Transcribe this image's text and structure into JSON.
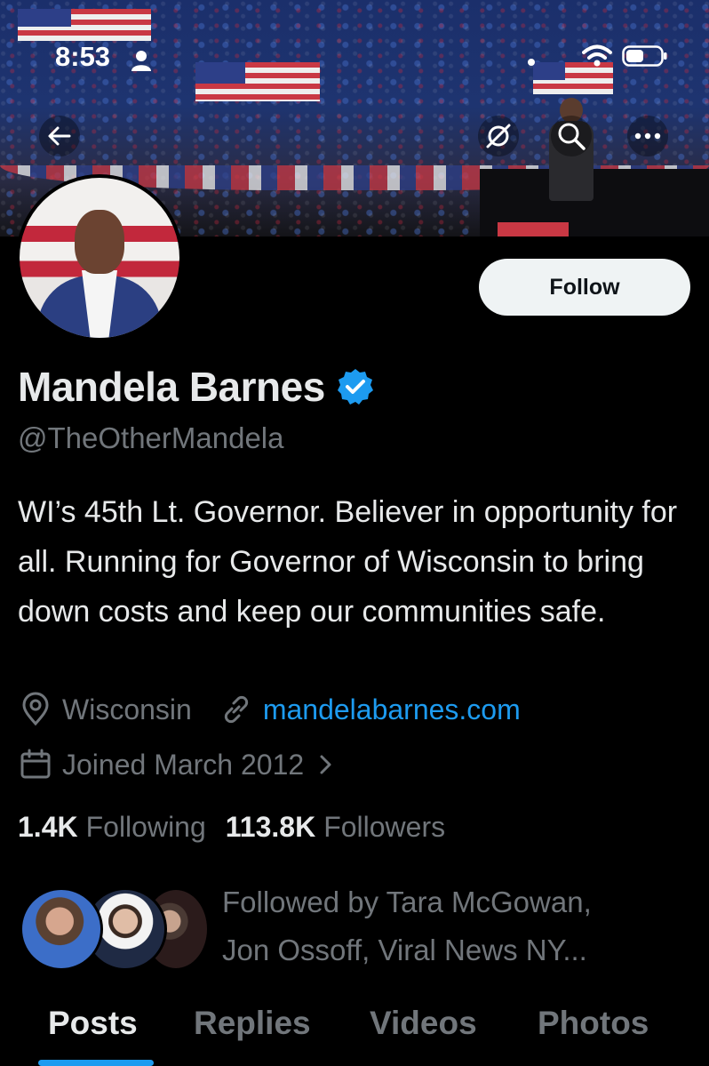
{
  "status_bar": {
    "time": "8:53"
  },
  "profile": {
    "name": "Mandela Barnes",
    "handle": "@TheOtherMandela",
    "bio": "WI’s 45th Lt. Governor. Believer in opportunity for all. Running for Governor of Wisconsin to bring down costs and keep our communities safe.",
    "location": "Wisconsin",
    "website": "mandelabarnes.com",
    "joined": "Joined March 2012",
    "following_count": "1.4K",
    "following_label": "Following",
    "followers_count": "113.8K",
    "followers_label": "Followers",
    "followed_by_line1": "Followed by Tara McGowan,",
    "followed_by_line2": "Jon Ossoff, Viral News NY..."
  },
  "actions": {
    "follow_label": "Follow"
  },
  "tabs": [
    {
      "label": "Posts",
      "active": true
    },
    {
      "label": "Replies",
      "active": false
    },
    {
      "label": "Videos",
      "active": false
    },
    {
      "label": "Photos",
      "active": false
    }
  ],
  "icons": {
    "back": "back-arrow-icon",
    "hide": "eye-off-icon",
    "search": "search-icon",
    "more": "more-icon",
    "verified": "verified-badge-icon",
    "location": "location-pin-icon",
    "link": "link-icon",
    "calendar": "calendar-icon"
  },
  "colors": {
    "accent": "#1d9bf0",
    "text": "#e7e9ea",
    "muted": "#71767b",
    "background": "#000000"
  }
}
